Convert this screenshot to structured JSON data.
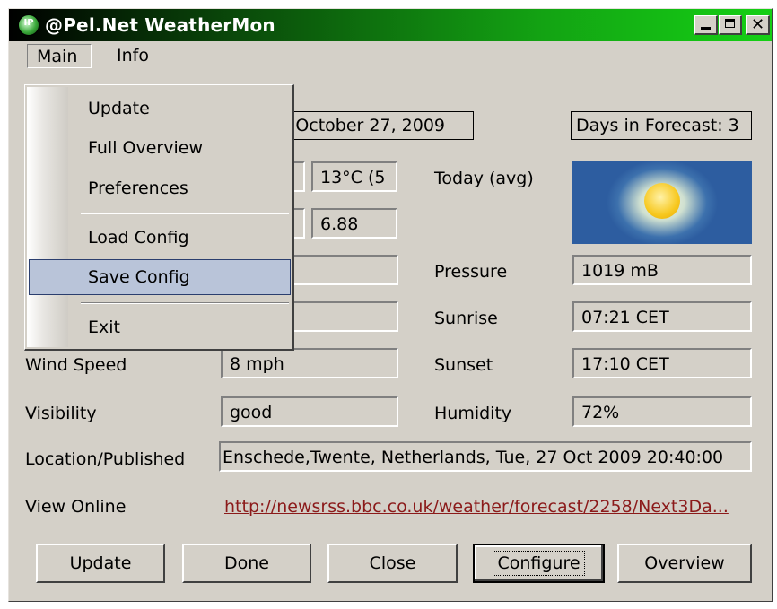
{
  "window": {
    "title": "@Pel.Net WeatherMon",
    "icon": "weathermon-globe-icon",
    "icon_text": "IP",
    "close_glyph": "✕"
  },
  "menubar": {
    "main": "Main",
    "info": "Info"
  },
  "dropdown": {
    "items": [
      {
        "label": "Update"
      },
      {
        "label": "Full Overview"
      },
      {
        "label": "Preferences"
      },
      {
        "label": "Load Config"
      },
      {
        "label": "Save Config"
      },
      {
        "label": "Exit"
      }
    ],
    "highlighted": "Save Config"
  },
  "header": {
    "date_fragment": "y, October 27, 2009",
    "days_forecast": "Days in Forecast: 3"
  },
  "values": {
    "temp_fragment": "13°C (5",
    "second_fragment": "6.88"
  },
  "labels": {
    "today_avg": "Today (avg)",
    "pressure": "Pressure",
    "sunrise": "Sunrise",
    "sunset": "Sunset",
    "humidity": "Humidity",
    "wind_speed": "Wind Speed",
    "visibility": "Visibility",
    "location": "Location/Published",
    "view_online": "View Online"
  },
  "fields": {
    "pressure": "1019 mB",
    "sunrise": "07:21 CET",
    "sunset": "17:10 CET",
    "humidity": "72%",
    "wind_speed": "8 mph",
    "visibility": "good",
    "location": "Enschede,Twente, Netherlands, Tue, 27 Oct 2009 20:40:00",
    "link": "http://newsrss.bbc.co.uk/weather/forecast/2258/Next3Da..."
  },
  "buttons": {
    "update": "Update",
    "done": "Done",
    "close": "Close",
    "configure": "Configure",
    "overview": "Overview"
  },
  "colors": {
    "link": "#8b1a1a",
    "title_gradient_end": "#15d015",
    "menu_highlight": "#b9c4d9"
  }
}
